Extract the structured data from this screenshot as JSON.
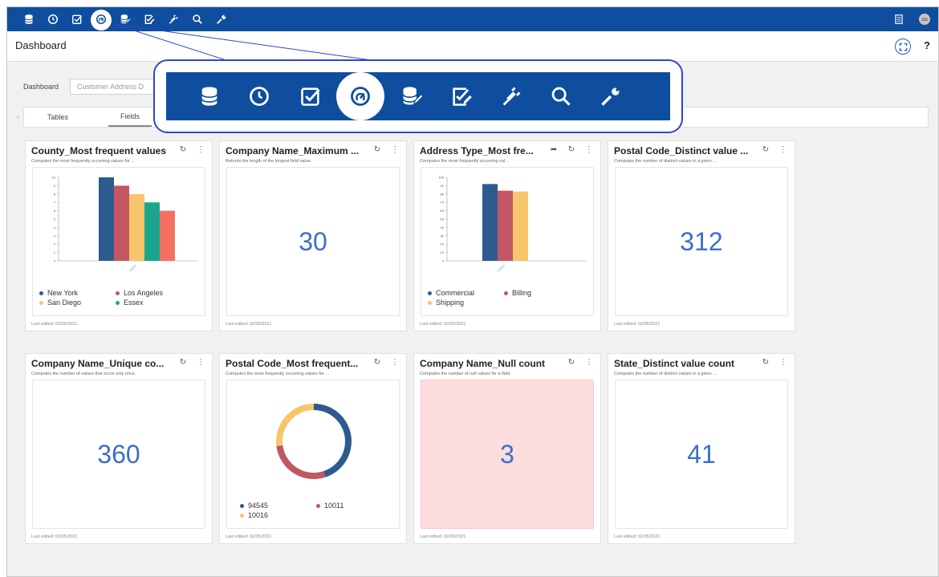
{
  "header": {
    "title": "Dashboard",
    "help": "?"
  },
  "avatar_initials": "aa",
  "topbar_icons": [
    "database-icon",
    "clock-icon",
    "checkbox-icon",
    "gauge-icon",
    "database-edit-icon",
    "checkbox-edit-icon",
    "plug-icon",
    "search-icon",
    "wrench-icon"
  ],
  "topbar_active": "gauge-icon",
  "filter": {
    "label": "Dashboard",
    "value": "Customer Address D"
  },
  "tabs": [
    {
      "label": "Tables"
    },
    {
      "label": "Fields"
    }
  ],
  "cards": [
    {
      "title": "County_Most frequent values",
      "desc": "Computes the most frequently occurring values for ...",
      "footer": "Last edited: 02/05/2021",
      "type": "bar",
      "chart_data": {
        "type": "bar",
        "categories": [
          "02/05/2021"
        ],
        "series": [
          {
            "name": "New York",
            "values": [
              10
            ],
            "color": "#2e5b8f"
          },
          {
            "name": "Los Angeles",
            "values": [
              9
            ],
            "color": "#c45563"
          },
          {
            "name": "San Diego",
            "values": [
              8
            ],
            "color": "#f7c56b"
          },
          {
            "name": "Essex",
            "values": [
              7
            ],
            "color": "#1aa68c"
          },
          {
            "name": "",
            "values": [
              6
            ],
            "color": "#f56f63"
          }
        ],
        "ylim": [
          0,
          10
        ],
        "yticks": [
          "0",
          "1",
          "2",
          "3",
          "4",
          "5",
          "6",
          "7",
          "8",
          "9",
          "10"
        ],
        "legend": [
          "New York",
          "Los Angeles",
          "San Diego",
          "Essex"
        ]
      }
    },
    {
      "title": "Company Name_Maximum ...",
      "desc": "Returns the length of the longest field value.",
      "footer": "Last edited: 02/05/2021",
      "type": "number",
      "value": "30"
    },
    {
      "title": "Address Type_Most fre...",
      "desc": "Computes the most frequently occurring val...",
      "footer": "Last edited: 02/05/2021",
      "type": "bar",
      "share": true,
      "chart_data": {
        "type": "bar",
        "categories": [
          "02/05/2021"
        ],
        "series": [
          {
            "name": "Commercial",
            "values": [
              92
            ],
            "color": "#2e5b8f"
          },
          {
            "name": "Billing",
            "values": [
              84
            ],
            "color": "#c45563"
          },
          {
            "name": "Shipping",
            "values": [
              83
            ],
            "color": "#f7c56b"
          }
        ],
        "ylim": [
          0,
          100
        ],
        "yticks": [
          "0",
          "10",
          "20",
          "30",
          "40",
          "50",
          "60",
          "70",
          "80",
          "90",
          "100"
        ],
        "legend": [
          "Commercial",
          "Billing",
          "Shipping"
        ]
      }
    },
    {
      "title": "Postal Code_Distinct value ...",
      "desc": "Computes the number of distinct values in a given ...",
      "footer": "Last edited: 02/05/2021",
      "type": "number",
      "value": "312"
    },
    {
      "title": "Company Name_Unique co...",
      "desc": "Computes the number of values that occur only once.",
      "footer": "Last edited: 02/05/2021",
      "type": "number",
      "value": "360"
    },
    {
      "title": "Postal Code_Most frequent...",
      "desc": "Computes the most frequently occurring values for ...",
      "footer": "Last edited: 02/05/2021",
      "type": "pie",
      "chart_data": {
        "type": "pie",
        "slices": [
          {
            "name": "94545",
            "value": 45,
            "color": "#2e5b8f"
          },
          {
            "name": "10011",
            "value": 28,
            "color": "#c45563"
          },
          {
            "name": "10016",
            "value": 27,
            "color": "#f7c56b"
          }
        ],
        "legend": [
          "94545",
          "10011",
          "10016"
        ]
      }
    },
    {
      "title": "Company Name_Null count",
      "desc": "Computes the number of null values for a field.",
      "footer": "Last edited: 02/05/2021",
      "type": "number",
      "highlight": true,
      "value": "3"
    },
    {
      "title": "State_Distinct value count",
      "desc": "Computes the number of distinct values in a given ...",
      "footer": "Last edited: 02/05/2021",
      "type": "number",
      "value": "41"
    }
  ]
}
